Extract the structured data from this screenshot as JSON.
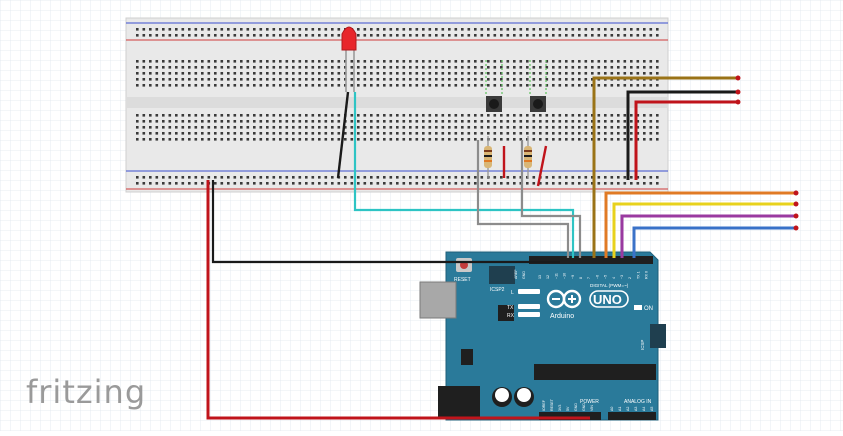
{
  "watermark": "fritzing",
  "arduino": {
    "brand_text": "Arduino",
    "model_text": "UNO",
    "on_label": "ON",
    "reset_label": "RESET",
    "icsp_label": "ICSP2",
    "icsp_label_right": "ICSP",
    "digital_label": "DIGITAL (PWM=~)",
    "power_label": "POWER",
    "analog_label": "ANALOG IN",
    "led_labels": [
      "L",
      "TX",
      "RX"
    ],
    "aref_label": "AREF",
    "gnd_label": "GND",
    "digital_pins": [
      "13",
      "12",
      "~11",
      "~10",
      "~9",
      "8",
      "7",
      "~6",
      "~5",
      "4",
      "~3",
      "2",
      "TX 1",
      "RX 0"
    ],
    "power_pins": [
      "IOREF",
      "RESET",
      "3V3",
      "5V",
      "GND",
      "GND",
      "VIN"
    ],
    "analog_pins": [
      "A0",
      "A1",
      "A2",
      "A3",
      "A4",
      "A5"
    ]
  },
  "colors": {
    "board": "#2a7a9a",
    "wire_red": "#c0141b",
    "wire_black": "#1a1a1a",
    "wire_cyan": "#2ec4c4",
    "wire_gray": "#8c8c8c",
    "wire_brown": "#9a7317",
    "wire_orange": "#e07a24",
    "wire_yellow": "#e8d21c",
    "wire_purple": "#9a3aa0",
    "wire_blue": "#3a72c8",
    "led_red": "#e8262b"
  }
}
